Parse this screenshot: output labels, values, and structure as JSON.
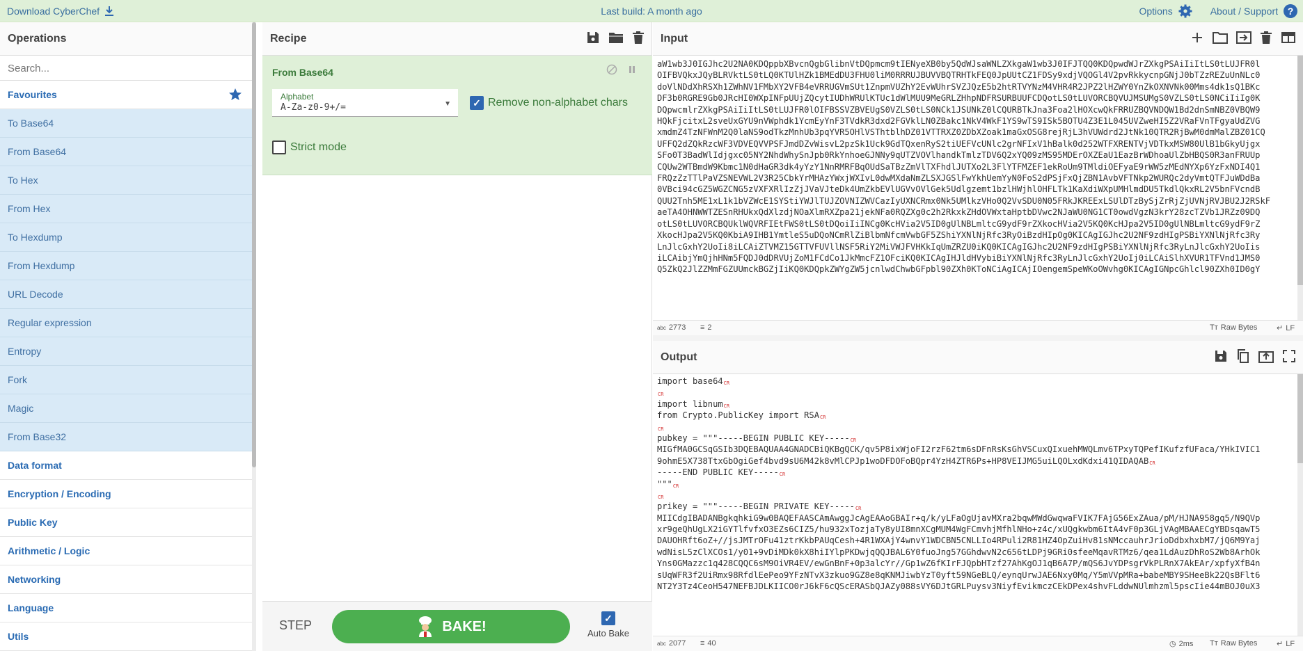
{
  "banner": {
    "download_label": "Download CyberChef",
    "build_label": "Last build: A month ago",
    "options_label": "Options",
    "about_label": "About / Support"
  },
  "operations": {
    "title": "Operations",
    "search_placeholder": "Search...",
    "favourites_label": "Favourites",
    "favourites": [
      "To Base64",
      "From Base64",
      "To Hex",
      "From Hex",
      "To Hexdump",
      "From Hexdump",
      "URL Decode",
      "Regular expression",
      "Entropy",
      "Fork",
      "Magic",
      "From Base32"
    ],
    "categories": [
      "Data format",
      "Encryption / Encoding",
      "Public Key",
      "Arithmetic / Logic",
      "Networking",
      "Language",
      "Utils"
    ]
  },
  "recipe": {
    "title": "Recipe",
    "operation_name": "From Base64",
    "alphabet_label": "Alphabet",
    "alphabet_value": "A-Za-z0-9+/=",
    "remove_nonalpha_label": "Remove non-alphabet chars",
    "remove_nonalpha_checked": true,
    "strict_mode_label": "Strict mode",
    "strict_mode_checked": false,
    "step_label": "STEP",
    "bake_label": "BAKE!",
    "autobake_label": "Auto Bake",
    "autobake_checked": true
  },
  "input": {
    "title": "Input",
    "lines": [
      "aW1wb3J0IGJhc2U2NA0KDQppbXBvcnQgbGlibnVtDQpmcm9tIENyeXB0by5QdWJsaWNLZXkgaW1wb3J0IFJTQQ0KDQpwdWJrZXkgPSAiIiItLS0tLUJFR0l",
      "OIFBVQkxJQyBLRVktLS0tLQ0KTUlHZk1BMEdDU3FHU0liM0RRRUJBUVVBQTRHTkFEQ0JpUUtCZ1FDSy9xdjVQOGl4V2pvRkkycnpGNjJ0bTZzREZuUnNLc0",
      "doVlNDdXhRSXh1ZWhNV1FMbXY2VFB4eVRRUGVmSUt1ZnpmVUZhY2EvWUhrSVZJQzE5b2htRTVYNzM4VHR4R2JPZ2lHZWY0YnZkOXNVNk00Mms4dk1sQ1BKc",
      "DF3b0RGRE9Gb0JRcHI0WXpINFpUUjZQcytIUDhWRUlKTUc1dWlMUU9MeGRLZHhpNDFRSURBUUFCDQotLS0tLUVORCBQVUJMSUMgS0VZLS0tLS0NCiIiIg0K",
      "DQpwcmlrZXkgPSAiIiItLS0tLUJFR0lOIFBSSVZBVEUgS0VZLS0tLS0NCk1JSUNkZ0lCQURBTkJna3Foa2lHOXcwQkFRRUZBQVNDQW1Bd2dnSmNBZ0VBQW9",
      "HQkFjcitxL2sveUxGYU9nVWphdk1YcmEyYnF3TVdkR3dxd2FGVklLN0ZBakc1NkV4WkF1YS9wTS9ISk5BOTU4Z3E1L045UVZweHI5Z2VRaFVnTFgyaUdZVG",
      "xmdmZ4TzNFWnM2Q0laNS9odTkzMnhUb3pqYVR5OHlVSThtblhDZ01VTTRXZ0ZDbXZoak1maGxOSG8rejRjL3hVUWdrd2JtNk10QTR2RjBwM0dmMalZBZ01CQ",
      "UFFQ2dZQkRzcWF3VDVEQVVPSFJmdDZvWisvL2pzSk1Uck9GdTQxenRyS2tiUEFVcUNlc2grNFIxV1hBalk0d252WTFXRENTVjVDTkxMSW80UlB1bGkyUjgx",
      "SFo0T3BadWlIdjgxc05NY2NhdWhySnJpb0RkYnhoeGJNNy9qUTZVOVlhandkTmlzTDV6Q2xYQ09zMS95MDErOXZEaU1EazBrWDhoaUlZbHBQS0R3anFRUUp",
      "CQUw2WTBmdW9Kbmc1N0dHaGR3dk4yYzY1NnRMRFBqOUdSaTBzZmVlTXFhdlJUTXo2L3FlYTFMZEF1ekRoUm9TMldiOEFyaE9rWW5zMEdNYXp6YzFxNDI4Q1",
      "FRQzZzTTlPaVZSNEVWL2V3R25CbkYrMHAzYWxjWXIvL0dwMXdaNmZLSXJGSlFwYkhUemYyN0FoS2dPSjFxQjZBN1AvbVFTNkp2WURQc2dyVmtQTFJuWDdBa",
      "0VBci94cGZ5WGZCNG5zVXFXRlIzZjJVaVJteDk4UmZkbEVlUGVvOVlGek5Udlgzemt1bzlHWjhlOHFLTk1KaXdiWXpUMHlmdDU5TkdlQkxRL2V5bnFVcndB",
      "QUU2Tnh5ME1xL1k1bVZWcE1SYStiYWJlTUJZOVNIZWVCazIyUXNCRmx0Nk5UMlkzVHo0Q2VvSDU0N05FRkJKREExLSUlDTzBySjZrRjZjUVNjRVJBU2J2RSkF",
      "aeTA4OHNWWTZESnRHUkxQdXlzdjNOaXlmRXZpa21jekNFa0RQZXg0c2h2RkxkZHdOVWxtaHptbDVwc2NJaWU0NG1CT0owdVgzN3krY28zcTZVb1JRZz09DQ",
      "otLS0tLUVORCBQUklWQVRFIEtFWS0tLS0tDQoiIiINCg0KcHVia2V5ID0gUlNBLmltcG9ydF9rZXkocHVia2V5KQ0KcHJpa2V5ID0gUlNBLmltcG9ydF9rZ",
      "XkocHJpa2V5KQ0KbiA9IHB1YmtleS5uDQoNCmRlZiBlbmNfcmVwbGF5ZShiYXNlNjRfc3RyOiBzdHIpOg0KICAgIGJhc2U2NF9zdHIgPSBiYXNlNjRfc3Ry",
      "LnJlcGxhY2UoIi8iLCAiZTVMZ15GTTVFUVllNSF5RiY2MiVWJFVHKkIqUmZRZU0iKQ0KICAgIGJhc2U2NF9zdHIgPSBiYXNlNjRfc3RyLnJlcGxhY2UoIis",
      "iLCAibjYmQjhHNm5FQDJ0dDRVUjZoM1FCdCo1JkMmcFZ1OFciKQ0KICAgIHJldHVybiBiYXNlNjRfc3RyLnJlcGxhY2UoIj0iLCAiSlhXVUR1TFVnd1JMS0",
      "Q5ZkQ2JlZZMmFGZUUmckBGZjIiKQ0KDQpkZWYgZW5jcnlwdChwbGFpbl90ZXh0KToNCiAgICAjIOengemSpeWKoOWvhg0KICAgIGNpcGhlcl90ZXh0ID0gY"
    ],
    "length": "2773",
    "lines_count": "2",
    "encoding": "Raw Bytes",
    "eol": "LF"
  },
  "output": {
    "title": "Output",
    "lines": [
      {
        "t": "import base64",
        "cr": true
      },
      {
        "t": "",
        "cr": true
      },
      {
        "t": "import libnum",
        "cr": true
      },
      {
        "t": "from Crypto.PublicKey import RSA",
        "cr": true
      },
      {
        "t": "",
        "cr": true
      },
      {
        "t": "pubkey = \"\"\"-----BEGIN PUBLIC KEY-----",
        "cr": true
      },
      {
        "t": "MIGfMA0GCSqGSIb3DQEBAQUAA4GNADCBiQKBgQCK/qv5P8ixWjoFI2rzF62tm6sDFnRsKsGhVSCuxQIxuehMWQLmv6TPxyTQPefIKufzfUFaca/YHkIVIC1",
        "cr": false
      },
      {
        "t": "9ohmE5X738TtxGbOgiGef4bvd9sU6M42k8vMlCPJp1woDFDOFoBQpr4YzH4ZTR6Ps+HP8VEIJMG5uiLQOLxdKdxi41QIDAQAB",
        "cr": true
      },
      {
        "t": "-----END PUBLIC KEY-----",
        "cr": true
      },
      {
        "t": "\"\"\"",
        "cr": true
      },
      {
        "t": "",
        "cr": true
      },
      {
        "t": "prikey = \"\"\"-----BEGIN PRIVATE KEY-----",
        "cr": true
      },
      {
        "t": "MIICdgIBADANBgkqhkiG9w0BAQEFAASCAmAwggJcAgEAAoGBAIr+q/k/yLFaOgUjavMXra2bqwMWdGwqwaFVIK7FAjG56ExZAua/pM/HJNA958gq5/N9QVp",
        "cr": false
      },
      {
        "t": "xr9geQhUgLX2iGYTlfvfxO3EZs6CIZ5/hu932xTozjaTy8yUI8mnXCgMUM4WgFCmvhjMfhlNHo+z4c/xUQgkwbm6ItA4vF0p3GLjVAgMBAAECgYBDsqawT5",
        "cr": false
      },
      {
        "t": "DAUOHRft6oZ+//jsJMTrOFu41ztrKkbPAUqCesh+4R1WXAjY4wnvY1WDCBN5CNLLIo4RPuli2R81HZ4OpZuiHv81sNMccauhrJrioDdbxhxbM7/jQ6M9Yaj",
        "cr": false
      },
      {
        "t": "wdNisL5zClXCOs1/y01+9vDiMDk0kX8hiIYlpPKDwjqQQJBAL6Y0fuoJng57GGhdwvN2c656tLDPj9GRi0sfeeMqavRTMz6/qea1LdAuzDhRoS2Wb8ArhOk",
        "cr": false
      },
      {
        "t": "Yns0GMazzc1q428CQQC6sM9OiVR4EV/ewGnBnF+0p3alcYr//Gp1wZ6fKIrFJQpbHTzf27AhKgOJ1qB6A7P/mQS6JvYDPsgrVkPLRnX7AkEAr/xpfyXfB4n",
        "cr": false
      },
      {
        "t": "sUqWFR3f2UiRmx98RfdlEePeo9YFzNTvX3zkuo9GZ8e8qKNMJiwbYzT0yft59NGeBLQ/eynqUrwJAE6Nxy0Mq/Y5mVVpMRa+babeMBY9SHeeBk22QsBFlt6",
        "cr": false
      },
      {
        "t": "NT2Y3Tz4CeoH547NEFBJDLKIICO0rJ6kF6cQScERASbQJAZy088sVY6DJtGRLPuysv3NiyfEvikmczCEkDPex4shvFLddwNUlmhzml5pscIie44mBOJ0uX3",
        "cr": false
      }
    ],
    "length": "2077",
    "lines_count": "40",
    "time": "2ms",
    "encoding": "Raw Bytes",
    "eol": "LF"
  },
  "colors": {
    "banner_bg": "#dff0d8",
    "favourite_bg": "#d9eaf7",
    "recipe_card_bg": "#dff0d8",
    "bake_button": "#4caf50",
    "link_blue": "#2e67b1",
    "cr_red": "#d32f2f"
  },
  "icons": {
    "download": "download-icon",
    "options": "gear-icon",
    "about": "question-icon",
    "favourites": "star-icon",
    "recipe_actions": [
      "save-icon",
      "folder-icon",
      "trash-icon"
    ],
    "input_actions": [
      "plus-icon",
      "folder-icon",
      "import-icon",
      "trash-icon",
      "layout-icon"
    ],
    "output_actions": [
      "save-icon",
      "copy-icon",
      "replace-input-icon",
      "maximize-icon"
    ]
  }
}
